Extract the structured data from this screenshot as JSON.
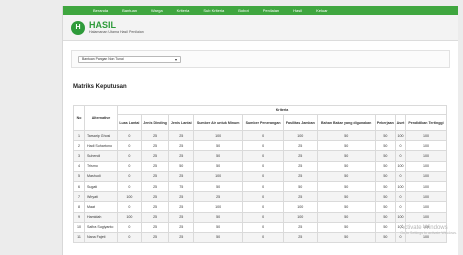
{
  "nav": [
    "Beranda",
    "Bantuan",
    "Warga",
    "Kriteria",
    "Sub Kriteria",
    "Bobot",
    "Penilaian",
    "Hasil",
    "Keluar"
  ],
  "header": {
    "logo_letter": "H",
    "title": "HASIL",
    "subtitle": "Halamanan Utama Hasil Penilaian"
  },
  "filter": {
    "selected": "Bantuan Pangan Non Tunai"
  },
  "section_title": "Matriks Keputusan",
  "table": {
    "no_label": "No",
    "alt_label": "Alternative",
    "kriteria_label": "Kriteria",
    "columns": [
      "Luas Lantai",
      "Jenis Dinding",
      "Jenis Lantai",
      "Sumber Air untuk Minum",
      "Sumber Penerangan",
      "Fasilitas Jamban",
      "Bahan Bakar yang digunakan",
      "Pekerjaan",
      "Aset",
      "Pendidikan Tertinggi"
    ],
    "rows": [
      {
        "no": "1",
        "name": "Tarsarip Ghosi",
        "vals": [
          "0",
          "25",
          "25",
          "100",
          "0",
          "100",
          "50",
          "50",
          "100",
          "100"
        ]
      },
      {
        "no": "2",
        "name": "Hadi Suhartono",
        "vals": [
          "0",
          "25",
          "25",
          "50",
          "0",
          "25",
          "50",
          "50",
          "0",
          "100"
        ]
      },
      {
        "no": "3",
        "name": "Suhendi",
        "vals": [
          "0",
          "25",
          "25",
          "50",
          "0",
          "25",
          "50",
          "50",
          "0",
          "100"
        ]
      },
      {
        "no": "4",
        "name": "Trismo",
        "vals": [
          "0",
          "25",
          "50",
          "50",
          "0",
          "25",
          "50",
          "50",
          "100",
          "100"
        ]
      },
      {
        "no": "5",
        "name": "Mashudi",
        "vals": [
          "0",
          "25",
          "25",
          "100",
          "0",
          "25",
          "50",
          "50",
          "0",
          "100"
        ]
      },
      {
        "no": "6",
        "name": "Sugati",
        "vals": [
          "0",
          "25",
          "75",
          "50",
          "0",
          "50",
          "50",
          "50",
          "100",
          "100"
        ]
      },
      {
        "no": "7",
        "name": "Wiryati",
        "vals": [
          "100",
          "25",
          "25",
          "25",
          "0",
          "25",
          "50",
          "50",
          "0",
          "100"
        ]
      },
      {
        "no": "8",
        "name": "Maat",
        "vals": [
          "0",
          "25",
          "25",
          "100",
          "0",
          "100",
          "50",
          "50",
          "0",
          "100"
        ]
      },
      {
        "no": "9",
        "name": "Hamidah",
        "vals": [
          "100",
          "25",
          "25",
          "50",
          "0",
          "100",
          "50",
          "50",
          "100",
          "100"
        ]
      },
      {
        "no": "10",
        "name": "Safira Sugiyanto",
        "vals": [
          "0",
          "25",
          "25",
          "50",
          "0",
          "25",
          "50",
          "50",
          "100",
          "100"
        ]
      },
      {
        "no": "11",
        "name": "Nana Fajeti",
        "vals": [
          "0",
          "25",
          "25",
          "50",
          "0",
          "25",
          "50",
          "50",
          "0",
          "100"
        ]
      }
    ]
  },
  "watermark": {
    "line1": "Activate Windows",
    "line2": "Go to Settings to activate Windows."
  },
  "colors": {
    "accent": "#3fa63f",
    "logo": "#2e9b3a"
  }
}
